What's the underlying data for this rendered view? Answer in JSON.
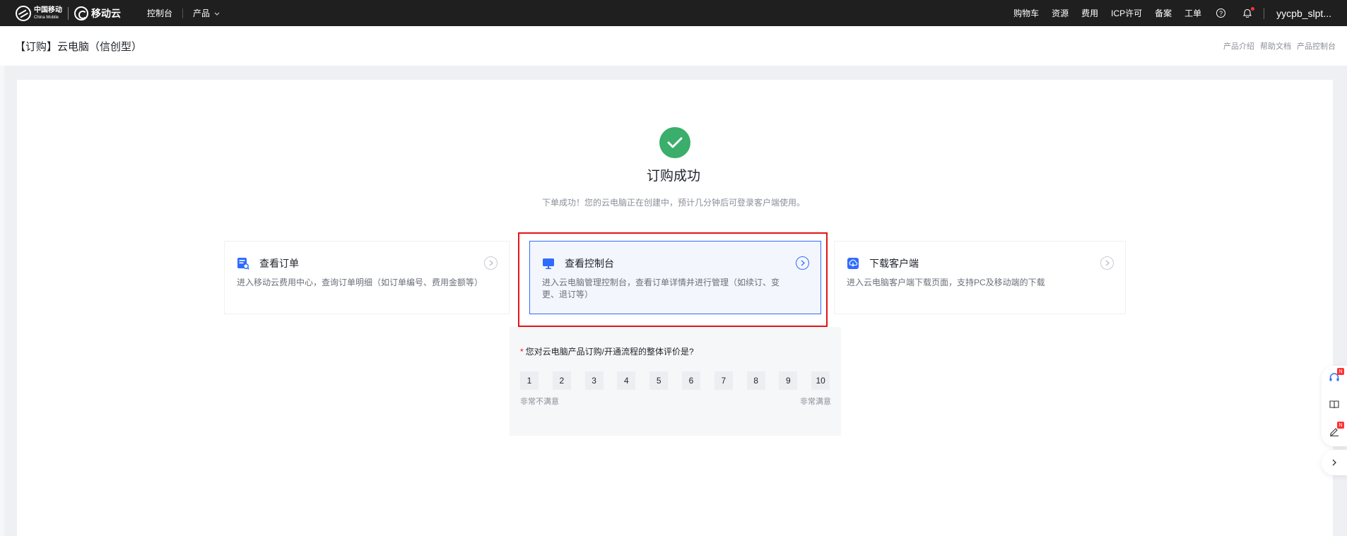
{
  "topbar": {
    "logo_cn": "中国移动",
    "logo_en": "China Mobile",
    "logo_brand": "移动云",
    "nav_left": [
      "控制台",
      "产品"
    ],
    "nav_right": [
      "购物车",
      "资源",
      "费用",
      "ICP许可",
      "备案",
      "工单"
    ],
    "help_glyph": "?",
    "user": "yycpb_slpt..."
  },
  "page": {
    "title": "【订购】云电脑（信创型）",
    "links": [
      "产品介绍",
      "帮助文档",
      "产品控制台"
    ]
  },
  "result": {
    "title": "订购成功",
    "desc": "下单成功！您的云电脑正在创建中，预计几分钟后可登录客户端使用。"
  },
  "cards": [
    {
      "title": "查看订单",
      "desc": "进入移动云费用中心，查询订单明细（如订单编号、费用金额等）",
      "icon": "order-search-icon"
    },
    {
      "title": "查看控制台",
      "desc": "进入云电脑管理控制台，查看订单详情并进行管理（如续订、变更、退订等）",
      "icon": "monitor-icon"
    },
    {
      "title": "下载客户端",
      "desc": "进入云电脑客户端下载页面，支持PC及移动端的下载",
      "icon": "download-client-icon"
    }
  ],
  "survey": {
    "required_mark": "*",
    "question": "您对云电脑产品订购/开通流程的整体评价是?",
    "scores": [
      "1",
      "2",
      "3",
      "4",
      "5",
      "6",
      "7",
      "8",
      "9",
      "10"
    ],
    "low_label": "非常不满意",
    "high_label": "非常满意"
  },
  "floatbar": {
    "badge_1": "N",
    "badge_3": "N"
  },
  "colors": {
    "success": "#3aae6a",
    "accent": "#2f6bff",
    "highlight_border": "#e41414"
  }
}
